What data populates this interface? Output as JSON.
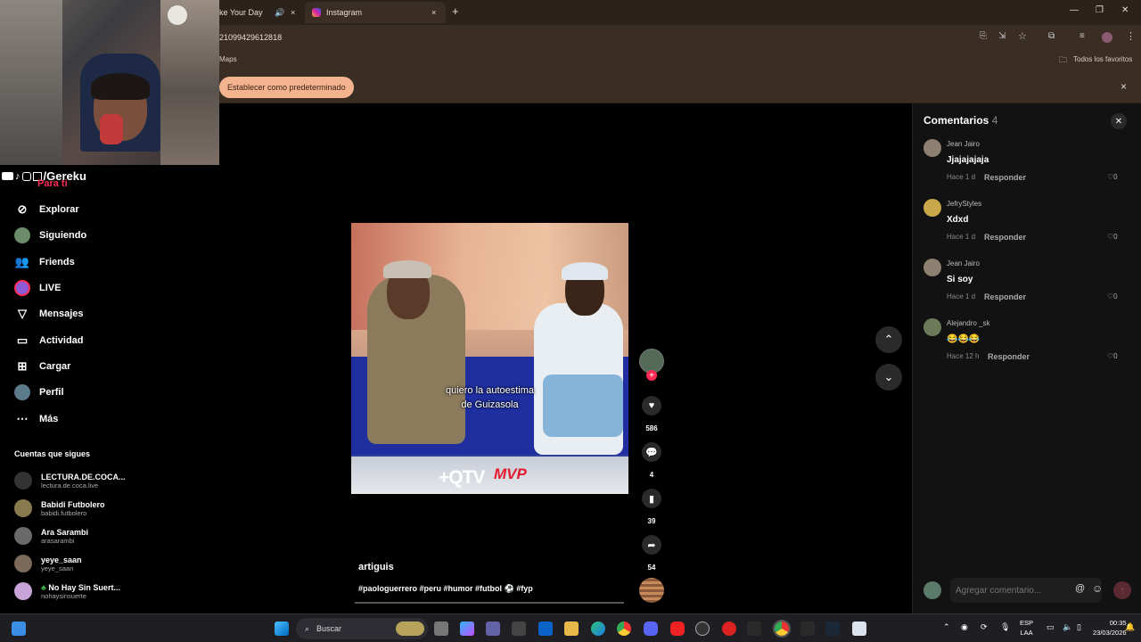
{
  "browser": {
    "tab_prev_label": "ke Your Day",
    "tab_active_label": "Instagram",
    "new_tab_symbol": "+",
    "address_text": "21099429612818",
    "bookmark_maps": "Maps",
    "bookmark_all": "Todos los favoritos",
    "default_browser_button": "Establecer como predeterminado",
    "close_symbol": "×"
  },
  "stream": {
    "handle": "/Gereku"
  },
  "sidebar": {
    "partial_item": "Para ti",
    "items": [
      {
        "label": "Explorar",
        "icon": "compass-icon"
      },
      {
        "label": "Siguiendo",
        "icon": "avatar-icon"
      },
      {
        "label": "Friends",
        "icon": "friends-icon"
      },
      {
        "label": "LIVE",
        "icon": "live-icon"
      },
      {
        "label": "Mensajes",
        "icon": "send-icon"
      },
      {
        "label": "Actividad",
        "icon": "activity-icon"
      },
      {
        "label": "Cargar",
        "icon": "upload-icon"
      },
      {
        "label": "Perfil",
        "icon": "profile-icon"
      },
      {
        "label": "Más",
        "icon": "more-icon"
      }
    ],
    "following_title": "Cuentas que sigues",
    "accounts": [
      {
        "name": "LECTURA.DE.COCA...",
        "handle": "lectura.de.coca.live"
      },
      {
        "name": "Babidi Futbolero",
        "handle": "babidi.futbolero"
      },
      {
        "name": "Ara Sarambi",
        "handle": "arasarambi"
      },
      {
        "name": "yeye_saan",
        "handle": "yeye_saan"
      },
      {
        "name": "No Hay Sin Suert...",
        "handle": "nohaysinsuerte"
      }
    ]
  },
  "video": {
    "caption_line1": "quiero la autoestima",
    "caption_line2": "de Guizasola",
    "logo_left": "+QTV",
    "logo_right": "MVP",
    "author": "artiguis",
    "hashtags": "#paologuerrero #peru #humor #futbol ⚽ #fyp",
    "likes": "586",
    "comments": "4",
    "saves": "39",
    "shares": "54"
  },
  "comments_panel": {
    "title": "Comentarios",
    "count": "4",
    "reply_label": "Responder",
    "input_placeholder": "Agregar comentario...",
    "items": [
      {
        "user": "Jean Jairo",
        "text": "Jjajajajaja",
        "time": "Hace 1 d",
        "likes": "0"
      },
      {
        "user": "JefryStyles",
        "text": "Xdxd",
        "time": "Hace 1 d",
        "likes": "0"
      },
      {
        "user": "Jean Jairo",
        "text": "Si soy",
        "time": "Hace 1 d",
        "likes": "0"
      },
      {
        "user": "Alejandro _sk",
        "text": "😂😂😂",
        "time": "Hace 12 h",
        "likes": "0"
      }
    ]
  },
  "taskbar": {
    "search_label": "Buscar",
    "lang_top": "ESP",
    "lang_bottom": "LAA",
    "time": "00:35",
    "date": "23/03/2026"
  },
  "colors": {
    "accent_pink": "#fe2c55",
    "button_peach": "#f3b38f"
  }
}
